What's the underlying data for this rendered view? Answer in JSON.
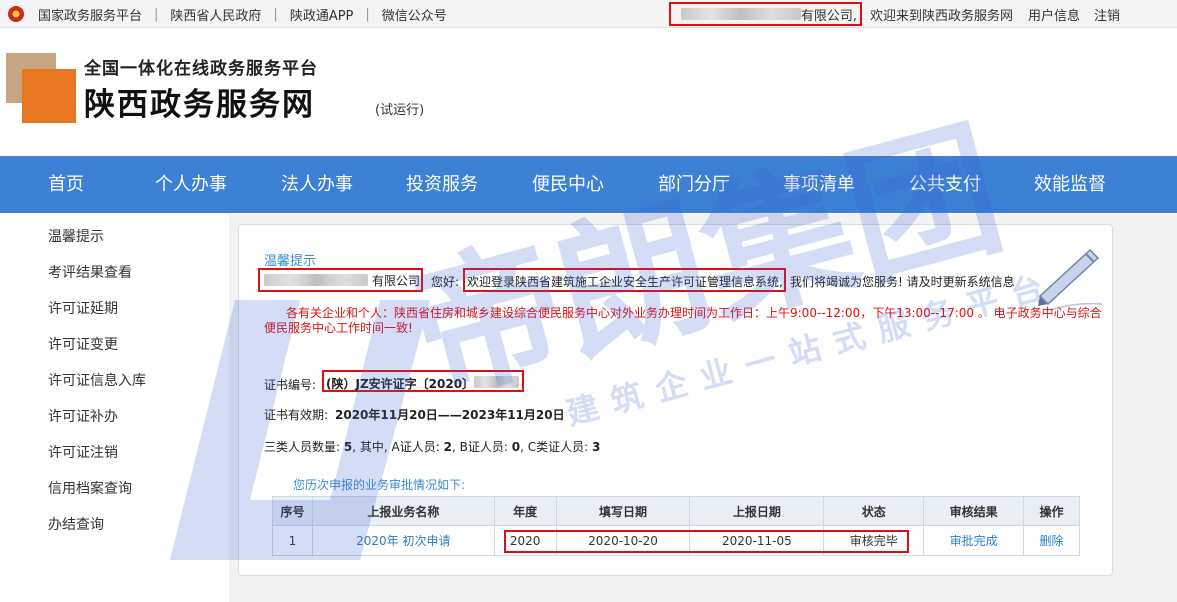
{
  "topbar": {
    "links": [
      "国家政务服务平台",
      "陕西省人民政府",
      "陕政通APP",
      "微信公众号"
    ],
    "separator": "|",
    "company_suffix": "有限公司,",
    "welcome": "欢迎来到陕西政务服务网",
    "user_info": "用户信息",
    "logout": "注销"
  },
  "header": {
    "subtitle": "全国一体化在线政务服务平台",
    "title": "陕西政务服务网",
    "trial": "(试运行)"
  },
  "nav": {
    "items": [
      "首页",
      "个人办事",
      "法人办事",
      "投资服务",
      "便民中心",
      "部门分厅",
      "事项清单",
      "公共支付",
      "效能监督"
    ]
  },
  "sidebar": {
    "items": [
      "温馨提示",
      "考评结果查看",
      "许可证延期",
      "许可证变更",
      "许可证信息入库",
      "许可证补办",
      "许可证注销",
      "信用档案查询",
      "办结查询"
    ]
  },
  "main": {
    "tip_title": "温馨提示",
    "company_suffix": "有限公司",
    "greeting": "您好:",
    "welcome_system": "欢迎登录陕西省建筑施工企业安全生产许可证管理信息系统,",
    "service_note": "我们将竭诚为您服务! 请及时更新系统信息",
    "notice_line1": "各有关企业和个人：陕西省住房和城乡建设综合便民服务中心对外业务办理时间为工作日：上午9:00--12:00，下午13:00--17:00 。 电子政务中心与综合",
    "notice_line2": "便民服务中心工作时间一致!",
    "cert_no_label": "证书编号:",
    "cert_no_value": "(陕）JZ安许证字〔2020〕",
    "validity_label": "证书有效期:",
    "validity_value": "2020年11月20日——2023年11月20日",
    "staff_label": "三类人员数量:",
    "staff_total": "5",
    "staff_sep": ", 其中,",
    "a_label": "A证人员:",
    "a_value": "2",
    "b_label": "B证人员:",
    "b_value": "0",
    "c_label": "C类证人员:",
    "c_value": "3"
  },
  "history": {
    "caption": "您历次申报的业务审批情况如下:",
    "headers": [
      "序号",
      "上报业务名称",
      "年度",
      "填写日期",
      "上报日期",
      "状态",
      "审核结果",
      "操作"
    ],
    "rows": [
      {
        "index": "1",
        "name": "2020年 初次申请",
        "year": "2020",
        "fill_date": "2020-10-20",
        "report_date": "2020-11-05",
        "status": "审核完毕",
        "result": "审批完成",
        "action": "删除"
      }
    ]
  },
  "watermark": {
    "main": "帝朗集团",
    "sub": "建筑企业一站式服务平台"
  },
  "colors": {
    "nav_bg": "#3c81d6",
    "highlight": "#e01010",
    "link": "#2a7fc6",
    "tip_title": "#3a8ec8"
  }
}
